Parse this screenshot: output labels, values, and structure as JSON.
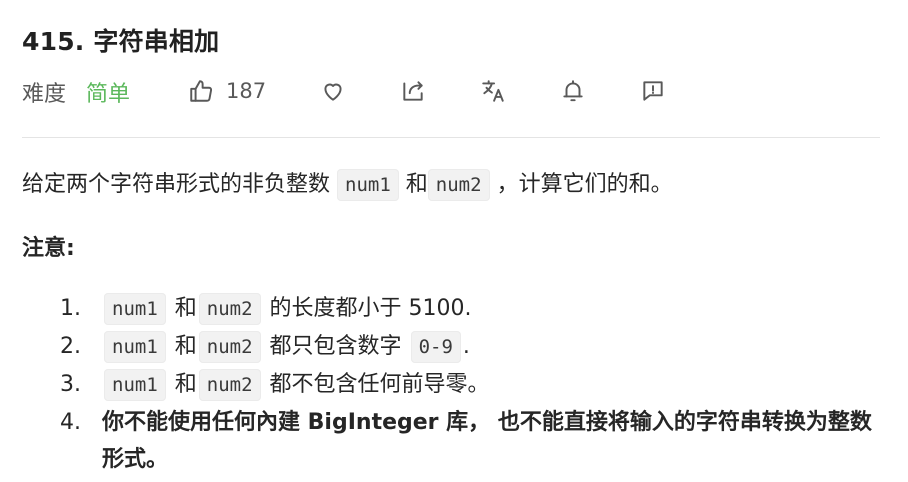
{
  "problem": {
    "title": "415. 字符串相加"
  },
  "toolbar": {
    "difficulty_label": "难度",
    "difficulty_value": "简单",
    "like_count": "187",
    "icons": [
      "thumbs-up-icon",
      "heart-icon",
      "share-icon",
      "translate-icon",
      "bell-icon",
      "feedback-icon"
    ],
    "difficulty_color": "#5cb85c"
  },
  "description": {
    "intro_prefix": "给定两个字符串形式的非负整数",
    "code_num1": "num1",
    "and": "和",
    "code_num2": "num2",
    "intro_suffix": "，计算它们的和。",
    "note_label": "注意:",
    "notes": [
      {
        "number": "1.",
        "a": "num1",
        "and": "和",
        "b": "num2",
        "text": "的长度都小于 5100."
      },
      {
        "number": "2.",
        "a": "num1",
        "and": "和",
        "b": "num2",
        "text": "都只包含数字",
        "code_extra": "0-9",
        "suffix": "."
      },
      {
        "number": "3.",
        "a": "num1",
        "and": "和",
        "b": "num2",
        "text": "都不包含任何前导零。"
      },
      {
        "number": "4.",
        "text": "你不能使用任何內建 BigInteger 库， 也不能直接将输入的字符串转换为整数形式。"
      }
    ]
  }
}
